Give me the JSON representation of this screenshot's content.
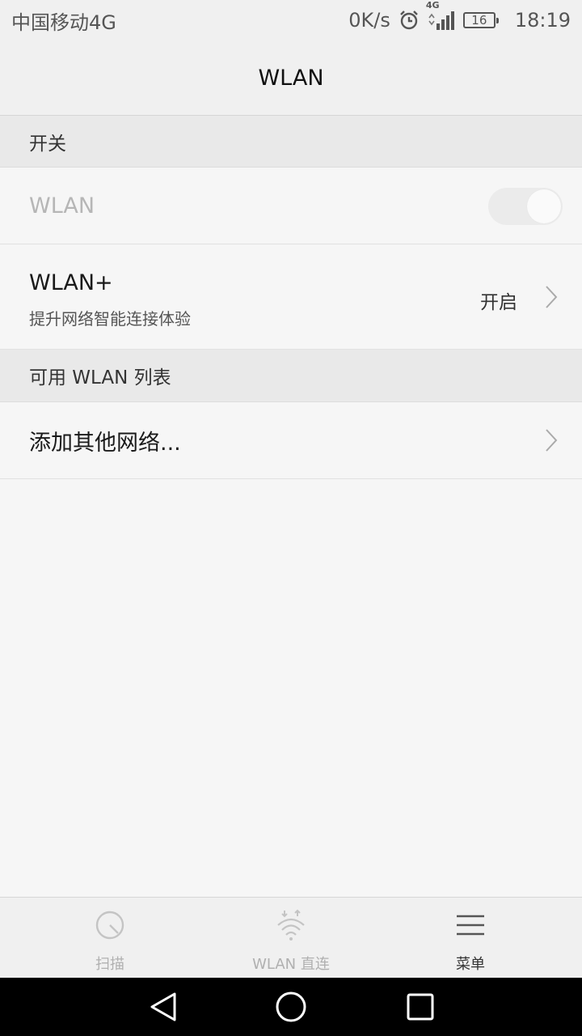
{
  "status_bar": {
    "carrier": "中国移动4G",
    "net_speed": "0K/s",
    "network_badge": "4G",
    "battery_level": "16",
    "time": "18:19",
    "icons": [
      "alarm-icon",
      "signal-icon",
      "battery-icon"
    ]
  },
  "title_bar": {
    "title": "WLAN"
  },
  "sections": {
    "switch_header": "开关",
    "available_header": "可用 WLAN 列表"
  },
  "wlan_row": {
    "label": "WLAN",
    "toggle_on": false
  },
  "wlan_plus_row": {
    "title": "WLAN+",
    "subtitle": "提升网络智能连接体验",
    "value": "开启"
  },
  "add_network_row": {
    "label": "添加其他网络..."
  },
  "bottom_tabs": [
    {
      "label": "扫描",
      "icon": "scan-icon",
      "active": false
    },
    {
      "label": "WLAN 直连",
      "icon": "wlan-direct-icon",
      "active": false
    },
    {
      "label": "菜单",
      "icon": "menu-icon",
      "active": true
    }
  ],
  "nav_bar": {
    "icons": [
      "back-icon",
      "home-icon",
      "recents-icon"
    ]
  },
  "colors": {
    "disabled_text": "#b6b6b6",
    "header_bg": "#e9e9e9",
    "page_bg": "#f6f6f6"
  }
}
